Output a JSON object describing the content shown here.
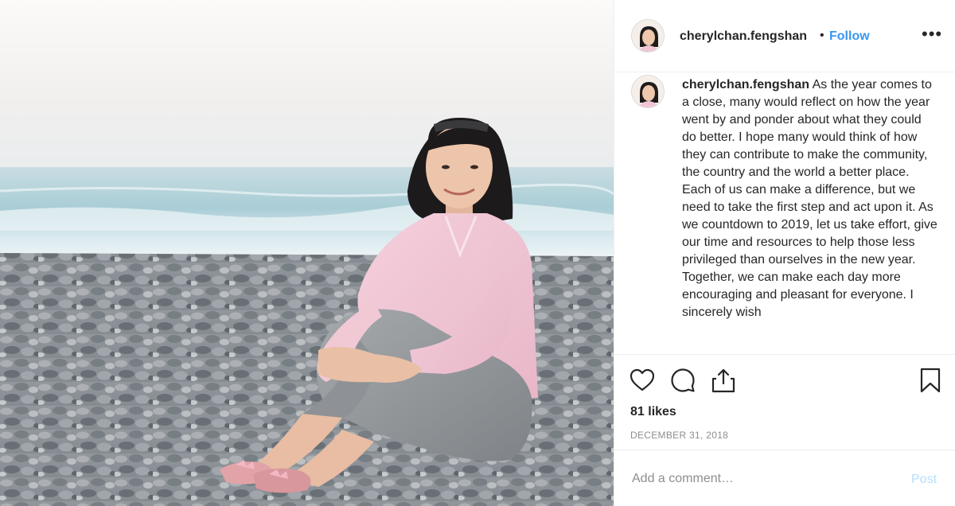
{
  "header": {
    "username": "cherylchan.fengshan",
    "separator": "•",
    "follow_label": "Follow",
    "more_label": "•••"
  },
  "caption": {
    "username": "cherylchan.fengshan",
    "text": "As the year comes to a close, many would reflect on how the year went by and ponder about what they could do better. I hope many would think of how they can contribute to make the community, the country and the world a better place. Each of us can make a difference, but we need to take the first step and act upon it. As we countdown to 2019, let us take effort, give our time and resources to help those less privileged than ourselves in the new year. Together, we can make each day more encouraging and pleasant for everyone. I sincerely wish"
  },
  "actions": {
    "icons": [
      "heart-icon",
      "comment-icon",
      "share-icon",
      "bookmark-icon"
    ],
    "likes": "81 likes",
    "date": "DECEMBER 31, 2018"
  },
  "comment": {
    "placeholder": "Add a comment…",
    "post_label": "Post"
  },
  "colors": {
    "link": "#3897f0",
    "post_disabled": "#b2dffc",
    "muted": "#8e8e8e",
    "border": "#efefef"
  }
}
